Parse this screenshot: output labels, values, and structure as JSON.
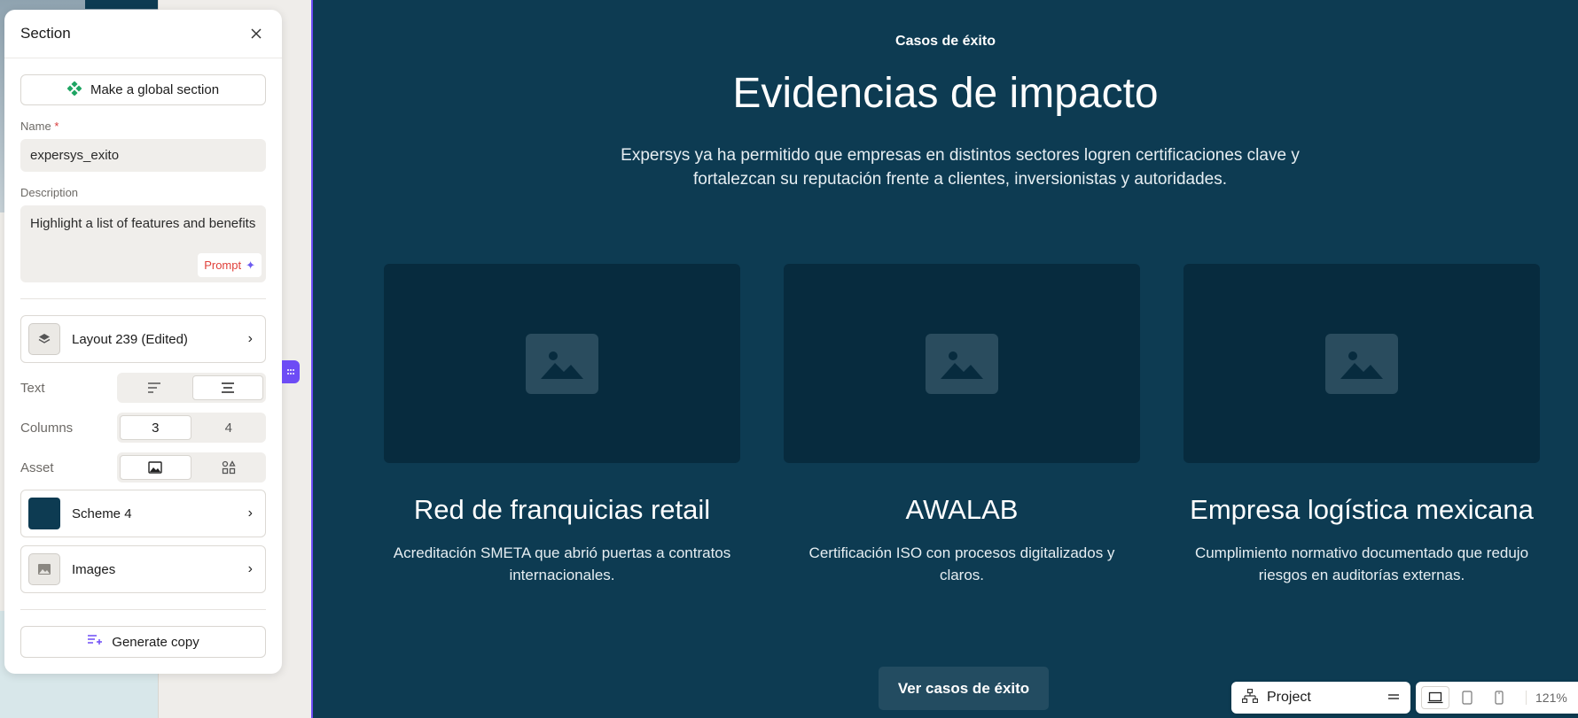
{
  "panel": {
    "title": "Section",
    "global_button": "Make a global section",
    "name_label": "Name",
    "name_required": "*",
    "name_value": "expersys_exito",
    "description_label": "Description",
    "description_value": "Highlight a list of features and benefits",
    "prompt_label": "Prompt",
    "layout_label": "Layout 239 (Edited)",
    "text_label": "Text",
    "columns_label": "Columns",
    "columns_options": [
      "3",
      "4"
    ],
    "asset_label": "Asset",
    "scheme_label": "Scheme 4",
    "images_label": "Images",
    "generate_label": "Generate copy"
  },
  "canvas": {
    "eyebrow": "Casos de éxito",
    "headline": "Evidencias de impacto",
    "subtext": "Expersys ya ha permitido que empresas en distintos sectores logren certificaciones clave y fortalezcan su reputación frente a clientes, inversionistas y autoridades.",
    "cards": [
      {
        "title": "Red de franquicias retail",
        "desc": "Acreditación SMETA que abrió puertas a contratos internacionales."
      },
      {
        "title": "AWALAB",
        "desc": "Certificación ISO con procesos digitalizados y claros."
      },
      {
        "title": "Empresa logística mexicana",
        "desc": "Cumplimiento normativo documentado que redujo riesgos en auditorías externas."
      }
    ],
    "cta": "Ver casos de éxito"
  },
  "toolbar": {
    "project_label": "Project",
    "zoom": "121%"
  },
  "colors": {
    "scheme": "#0d3b52",
    "accent": "#6d4cf5"
  }
}
